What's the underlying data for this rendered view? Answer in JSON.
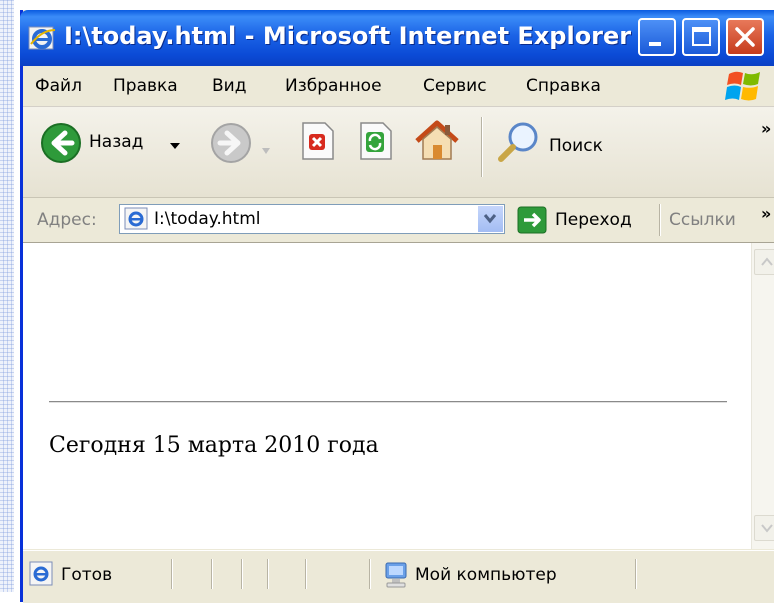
{
  "window": {
    "title": "I:\\today.html - Microsoft Internet Explorer"
  },
  "menu": {
    "items": [
      "Файл",
      "Правка",
      "Вид",
      "Избранное",
      "Сервис",
      "Справка"
    ]
  },
  "toolbar": {
    "back_label": "Назад",
    "search_label": "Поиск",
    "more_chevron": "»"
  },
  "address": {
    "label": "Адрес:",
    "value": "I:\\today.html",
    "go_label": "Переход",
    "links_label": "Ссылки",
    "more_chevron": "»"
  },
  "page": {
    "text": "Сегодня 15 марта 2010 года"
  },
  "status": {
    "left_text": "Готов",
    "zone_text": "Мой компьютер"
  },
  "colors": {
    "titlebar": "#0b4bd6",
    "chrome": "#ece9d8",
    "go_green": "#2e9a3a",
    "close_red": "#c53b1c"
  }
}
